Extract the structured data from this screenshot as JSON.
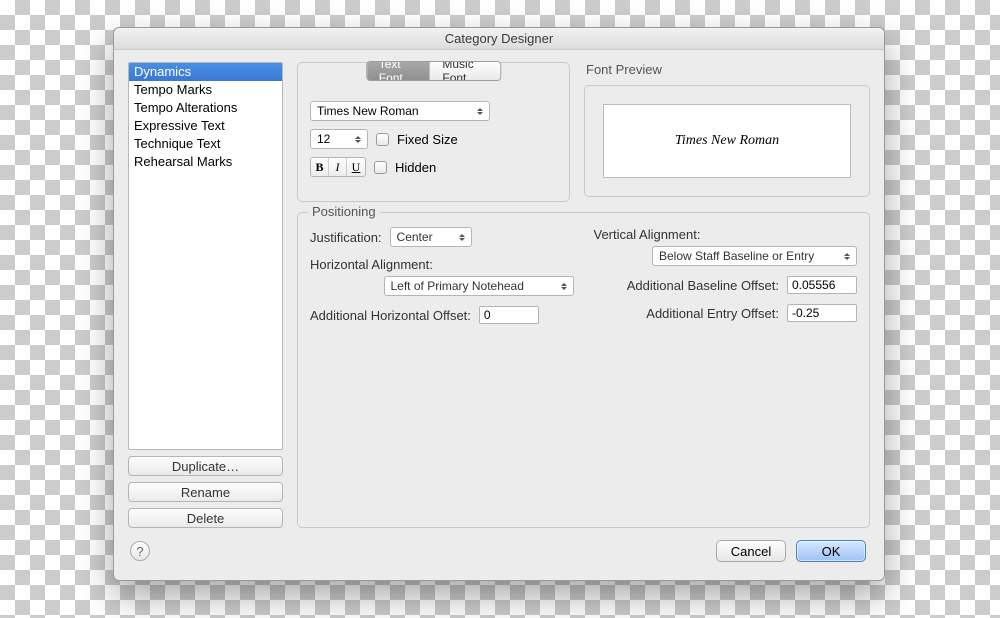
{
  "window": {
    "title": "Category Designer"
  },
  "categories": {
    "items": [
      {
        "label": "Dynamics",
        "selected": true
      },
      {
        "label": "Tempo Marks",
        "selected": false
      },
      {
        "label": "Tempo Alterations",
        "selected": false
      },
      {
        "label": "Expressive Text",
        "selected": false
      },
      {
        "label": "Technique Text",
        "selected": false
      },
      {
        "label": "Rehearsal Marks",
        "selected": false
      }
    ],
    "duplicate": "Duplicate…",
    "rename": "Rename",
    "delete": "Delete"
  },
  "font": {
    "tabs": {
      "text": "Text Font",
      "music": "Music Font",
      "active": "text"
    },
    "family": "Times New Roman",
    "size": "12",
    "fixed_label": "Fixed Size",
    "fixed": false,
    "hidden_label": "Hidden",
    "hidden": false
  },
  "preview": {
    "group_label": "Font Preview",
    "text": "Times New Roman"
  },
  "positioning": {
    "group_label": "Positioning",
    "justification_label": "Justification:",
    "justification": "Center",
    "h_align_label": "Horizontal Alignment:",
    "h_align": "Left of Primary Notehead",
    "h_offset_label": "Additional Horizontal Offset:",
    "h_offset": "0",
    "v_align_label": "Vertical Alignment:",
    "v_align": "Below Staff Baseline or Entry",
    "b_offset_label": "Additional Baseline Offset:",
    "b_offset": "0.05556",
    "e_offset_label": "Additional Entry Offset:",
    "e_offset": "-0.25"
  },
  "footer": {
    "help": "?",
    "cancel": "Cancel",
    "ok": "OK"
  }
}
